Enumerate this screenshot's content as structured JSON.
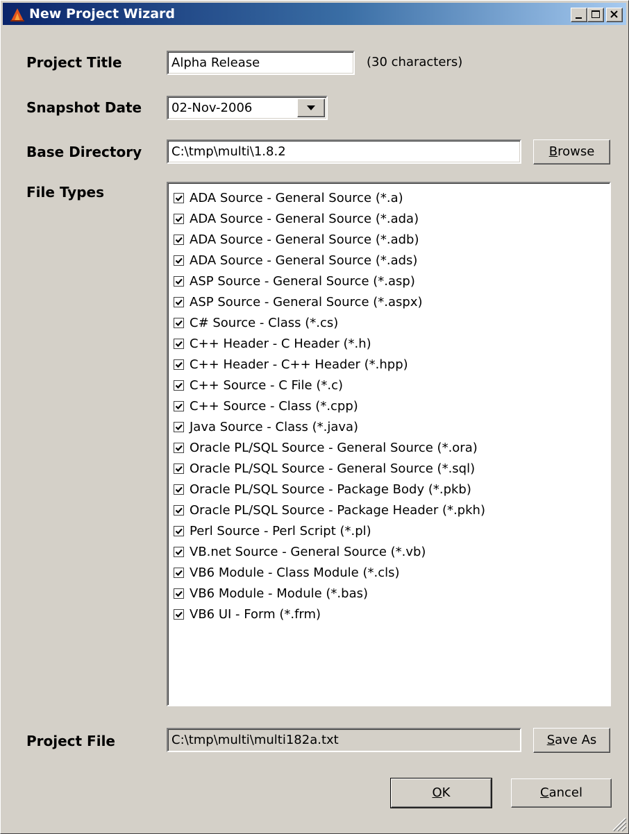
{
  "window": {
    "title": "New Project Wizard"
  },
  "form": {
    "project_title": {
      "label": "Project Title",
      "value": "Alpha Release",
      "hint": "(30 characters)"
    },
    "snapshot_date": {
      "label": "Snapshot Date",
      "value": "02-Nov-2006"
    },
    "base_directory": {
      "label": "Base Directory",
      "value": "C:\\tmp\\multi\\1.8.2",
      "browse_label": "Browse"
    },
    "file_types": {
      "label": "File Types",
      "items": [
        {
          "label": "ADA Source - General Source (*.a)",
          "checked": true
        },
        {
          "label": "ADA Source - General Source (*.ada)",
          "checked": true
        },
        {
          "label": "ADA Source - General Source (*.adb)",
          "checked": true
        },
        {
          "label": "ADA Source - General Source (*.ads)",
          "checked": true
        },
        {
          "label": "ASP Source - General Source (*.asp)",
          "checked": true
        },
        {
          "label": "ASP Source - General Source (*.aspx)",
          "checked": true
        },
        {
          "label": "C# Source - Class (*.cs)",
          "checked": true
        },
        {
          "label": "C++ Header - C Header (*.h)",
          "checked": true
        },
        {
          "label": "C++ Header - C++ Header (*.hpp)",
          "checked": true
        },
        {
          "label": "C++ Source - C File (*.c)",
          "checked": true
        },
        {
          "label": "C++ Source - Class (*.cpp)",
          "checked": true
        },
        {
          "label": "Java Source - Class (*.java)",
          "checked": true
        },
        {
          "label": "Oracle PL/SQL Source - General Source (*.ora)",
          "checked": true
        },
        {
          "label": "Oracle PL/SQL Source - General Source (*.sql)",
          "checked": true
        },
        {
          "label": "Oracle PL/SQL Source - Package Body (*.pkb)",
          "checked": true
        },
        {
          "label": "Oracle PL/SQL Source - Package Header (*.pkh)",
          "checked": true
        },
        {
          "label": "Perl Source - Perl Script (*.pl)",
          "checked": true
        },
        {
          "label": "VB.net Source - General Source (*.vb)",
          "checked": true
        },
        {
          "label": "VB6 Module - Class Module (*.cls)",
          "checked": true
        },
        {
          "label": "VB6 Module - Module (*.bas)",
          "checked": true
        },
        {
          "label": "VB6 UI - Form (*.frm)",
          "checked": true
        }
      ]
    },
    "project_file": {
      "label": "Project File",
      "value": "C:\\tmp\\multi\\multi182a.txt",
      "save_as_label": "Save As"
    }
  },
  "buttons": {
    "ok": "OK",
    "cancel": "Cancel"
  }
}
